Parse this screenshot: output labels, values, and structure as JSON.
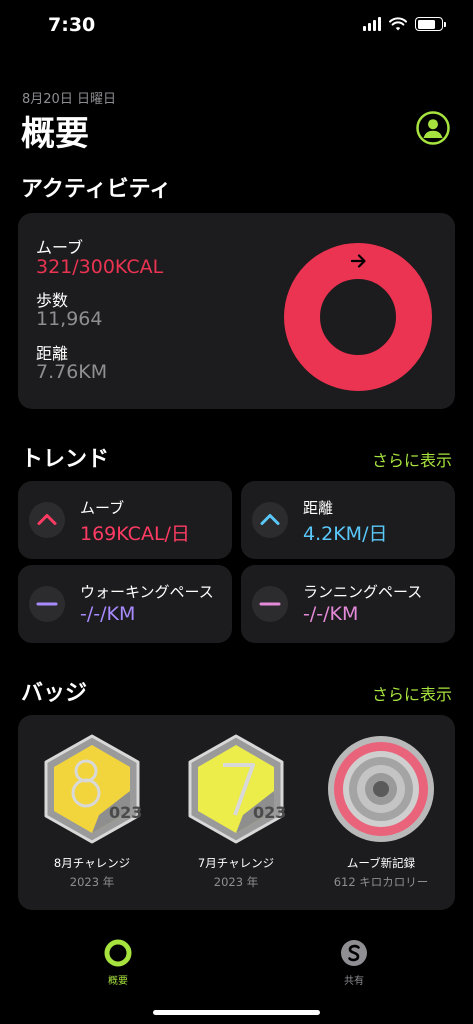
{
  "status": {
    "time": "7:30"
  },
  "header": {
    "date": "8月20日 日曜日",
    "title": "概要",
    "profile_icon": "person-circle-icon"
  },
  "activity": {
    "section_title": "アクティビティ",
    "move_label": "ムーブ",
    "move_value": "321/300KCAL",
    "move_progress": 1.07,
    "steps_label": "歩数",
    "steps_value": "11,964",
    "distance_label": "距離",
    "distance_value": "7.76KM"
  },
  "trends": {
    "section_title": "トレンド",
    "see_more": "さらに表示",
    "items": [
      {
        "label": "ムーブ",
        "value": "169KCAL/日",
        "icon": "chevron-up-icon",
        "color": "#ff3b63"
      },
      {
        "label": "距離",
        "value": "4.2KM/日",
        "icon": "chevron-up-icon",
        "color": "#5ac8fa"
      },
      {
        "label": "ウォーキングペース",
        "value": "-/-/KM",
        "icon": "dash-icon",
        "color": "#a98bff"
      },
      {
        "label": "ランニングペース",
        "value": "-/-/KM",
        "icon": "dash-icon",
        "color": "#e58ad9"
      }
    ]
  },
  "badges": {
    "section_title": "バッジ",
    "see_more": "さらに表示",
    "items": [
      {
        "name": "8月チャレンジ",
        "sub": "2023 年"
      },
      {
        "name": "7月チャレンジ",
        "sub": "2023 年"
      },
      {
        "name": "ムーブ新記録",
        "sub": "612 キロカロリー"
      }
    ]
  },
  "tabs": [
    {
      "label": "概要",
      "active": true
    },
    {
      "label": "共有",
      "active": false
    }
  ],
  "colors": {
    "accent": "#a7e33f",
    "move": "#eb3352",
    "card": "#1c1c1e",
    "muted": "#8e8e93"
  }
}
